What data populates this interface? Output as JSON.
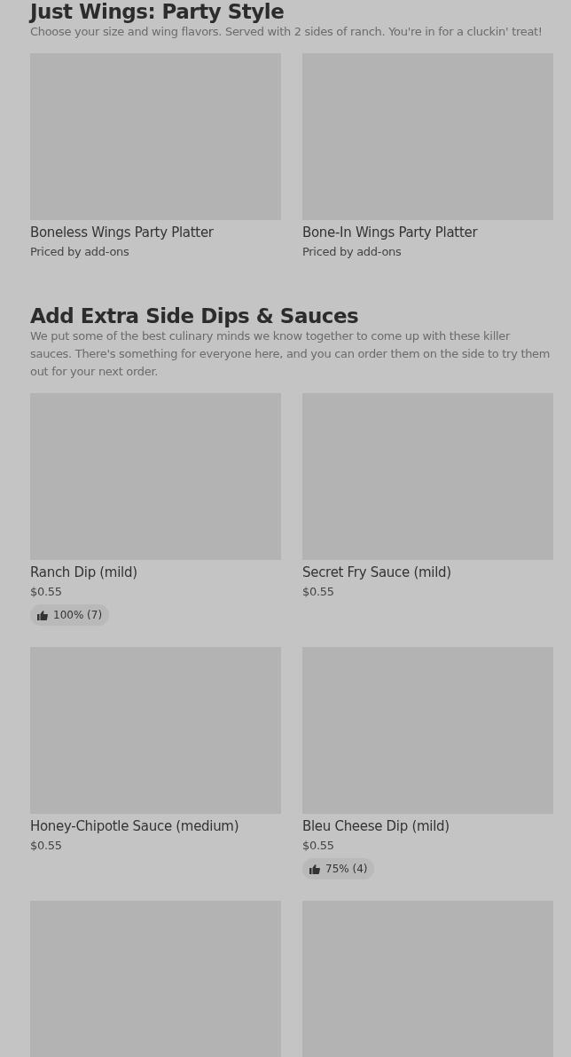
{
  "sections": [
    {
      "title": "Just Wings: Party Style",
      "description": "Choose your size and wing flavors. Served with 2 sides of ranch. You're in for a cluckin' treat!",
      "items": [
        {
          "kind": "item",
          "name": "Boneless Wings Party Platter",
          "price": "Priced by add-ons"
        },
        {
          "kind": "item",
          "name": "Bone-In Wings Party Platter",
          "price": "Priced by add-ons"
        }
      ]
    },
    {
      "title": "Add Extra Side Dips & Sauces",
      "description": "We put some of the best culinary minds we know together to come up with these killer sauces. There's something for everyone here, and you can order them on the side to try them out for your next order.",
      "items": [
        {
          "kind": "item",
          "name": "Ranch Dip (mild)",
          "price": "$0.55",
          "rating": "100% (7)"
        },
        {
          "kind": "item",
          "name": "Secret Fry Sauce (mild)",
          "price": "$0.55"
        },
        {
          "kind": "item",
          "name": "Honey-Chipotle Sauce (medium)",
          "price": "$0.55"
        },
        {
          "kind": "item",
          "name": "Bleu Cheese Dip (mild)",
          "price": "$0.55",
          "rating": "75% (4)"
        },
        {
          "kind": "picture"
        },
        {
          "kind": "picture"
        }
      ]
    }
  ]
}
